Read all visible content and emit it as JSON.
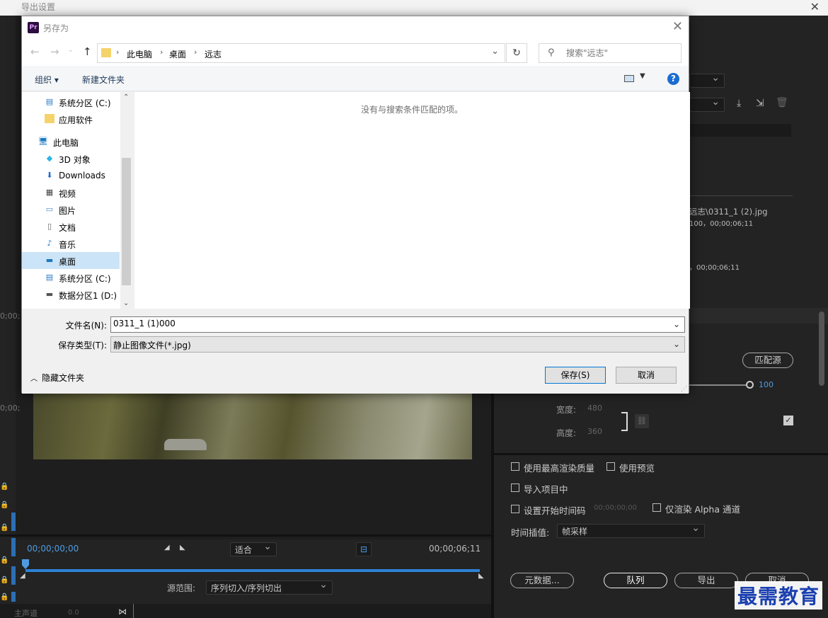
{
  "export_window": {
    "title": "导出设置",
    "source_path": "远志\\0311_1 (2).jpg",
    "info_line1": "100，00;00;06;11",
    "info_line2": "，00;00;06;11",
    "slider_value": "100",
    "match_source": "匹配源",
    "width_label": "宽度:",
    "width_value": "480",
    "height_label": "高度:",
    "height_value": "360",
    "timecode_start": "00;00;00;00",
    "timecode_end": "00;00;06;11",
    "fit_label": "适合",
    "source_range_label": "源范围:",
    "source_range_value": "序列切入/序列切出",
    "cb_max_render": "使用最高渲染质量",
    "cb_use_preview": "使用预览",
    "cb_import_project": "导入项目中",
    "cb_set_start_tc": "设置开始时间码",
    "start_tc_value": "00;00;00;00",
    "cb_render_alpha": "仅渲染 Alpha 通道",
    "interp_label": "时间插值:",
    "interp_value": "帧采样",
    "btn_metadata": "元数据...",
    "btn_queue": "队列",
    "btn_export": "导出",
    "btn_cancel": "取消",
    "left_tc": "0;00;",
    "track_label": "主声道",
    "track_value": "0.0"
  },
  "save_dialog": {
    "app_icon": "Pr",
    "title": "另存为",
    "breadcrumbs": [
      "此电脑",
      "桌面",
      "远志"
    ],
    "search_placeholder": "搜索\"远志\"",
    "organize": "组织 ▾",
    "new_folder": "新建文件夹",
    "nav_items": [
      {
        "label": "系统分区 (C:)",
        "icon": "drive-icon"
      },
      {
        "label": "应用软件",
        "icon": "folder-icon"
      },
      {
        "label": "此电脑",
        "icon": "computer-icon"
      },
      {
        "label": "3D 对象",
        "icon": "cube-icon"
      },
      {
        "label": "Downloads",
        "icon": "download-icon"
      },
      {
        "label": "视频",
        "icon": "video-icon"
      },
      {
        "label": "图片",
        "icon": "picture-icon"
      },
      {
        "label": "文档",
        "icon": "document-icon"
      },
      {
        "label": "音乐",
        "icon": "music-icon"
      },
      {
        "label": "桌面",
        "icon": "desktop-icon"
      },
      {
        "label": "系统分区 (C:)",
        "icon": "drive-icon"
      },
      {
        "label": "数据分区1 (D:)",
        "icon": "drive-icon"
      }
    ],
    "empty_message": "没有与搜索条件匹配的项。",
    "filename_label": "文件名(N):",
    "filename_value": "0311_1 (1)000",
    "filetype_label": "保存类型(T):",
    "filetype_value": "静止图像文件(*.jpg)",
    "hide_folders": "隐藏文件夹",
    "save_button": "保存(S)",
    "cancel_button": "取消"
  },
  "watermark": "最需教育",
  "colors": {
    "accent": "#4f9be0",
    "dialog_bg": "#f0f0f0",
    "selected": "#cce4f7",
    "dark_bg": "#232323"
  }
}
